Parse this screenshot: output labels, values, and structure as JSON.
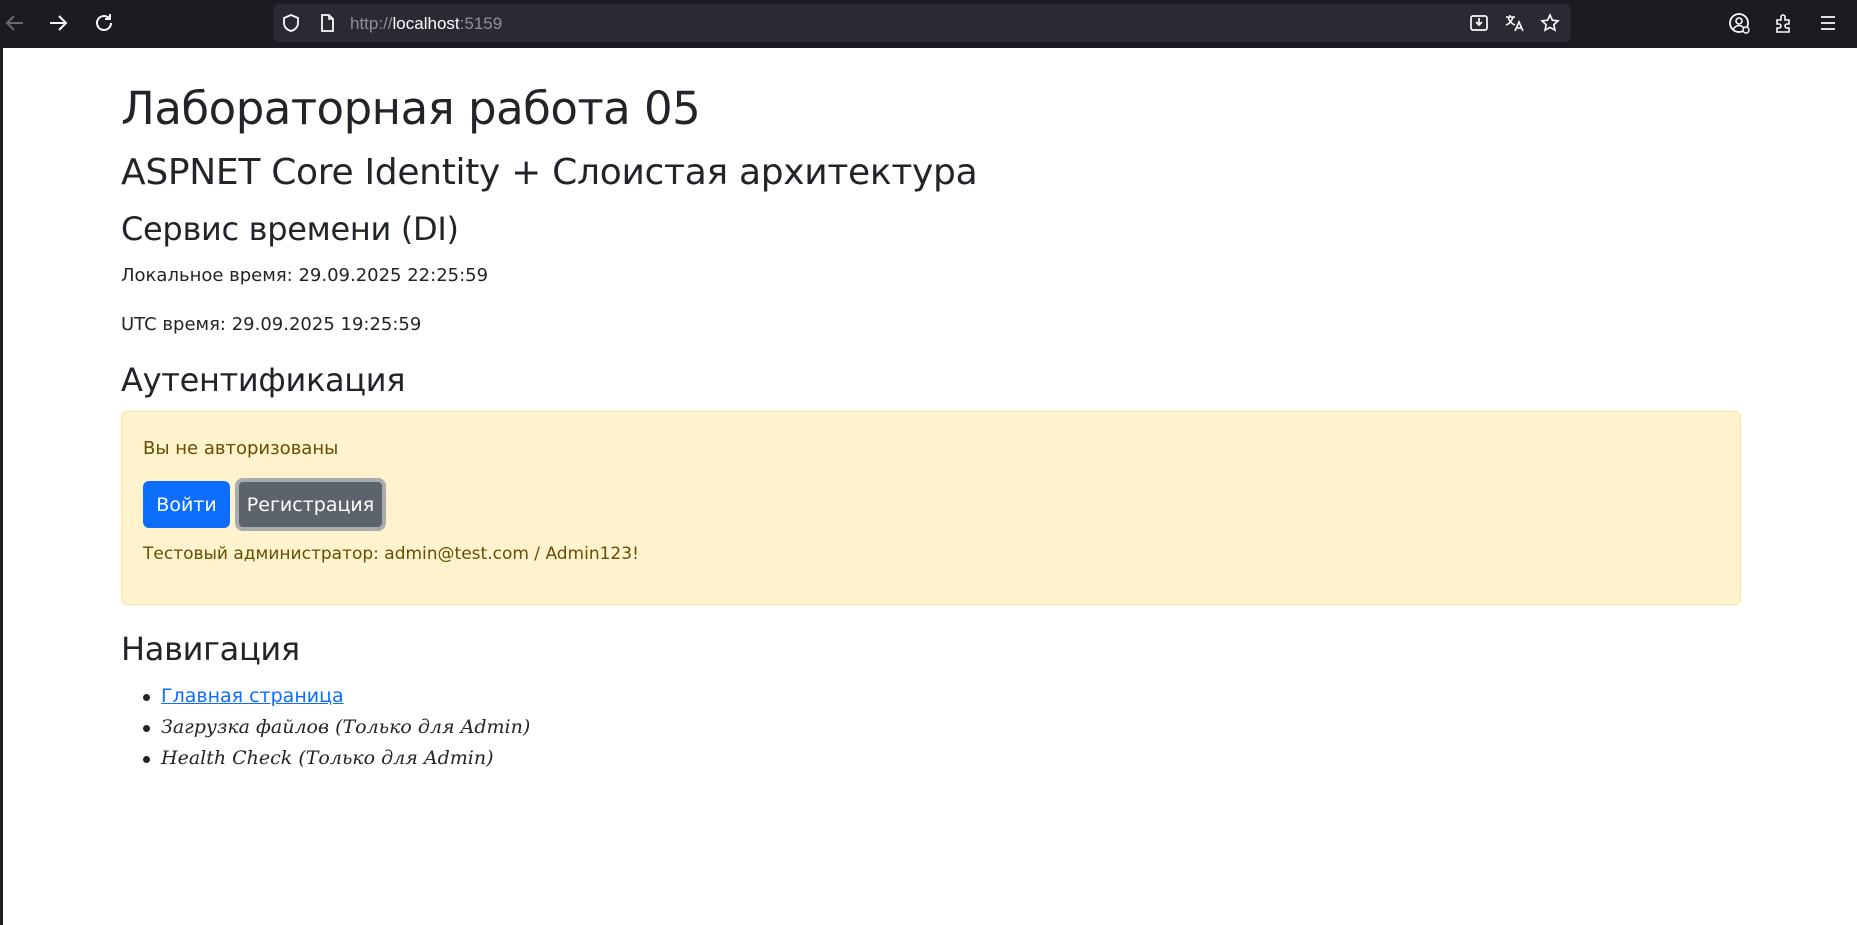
{
  "browser": {
    "url_scheme": "http://",
    "url_host": "localhost",
    "url_port": ":5159",
    "icons": [
      "back-arrow-icon",
      "forward-arrow-icon",
      "reload-icon",
      "shield-icon",
      "page-icon",
      "download-icon",
      "translate-icon",
      "star-icon",
      "account-icon",
      "extensions-icon",
      "menu-icon"
    ]
  },
  "page": {
    "title": "Лабораторная работа 05",
    "subtitle": "ASPNET Core Identity + Слоистая архитектура",
    "time_heading": "Сервис времени (DI)",
    "local_time": "Локальное время: 29.09.2025 22:25:59",
    "utc_time": "UTC время: 29.09.2025 19:25:59",
    "auth_heading": "Аутентификация",
    "auth": {
      "message": "Вы не авторизованы",
      "login_label": "Войти",
      "register_label": "Регистрация",
      "note": "Тестовый администратор: admin@test.com / Admin123!"
    },
    "nav_heading": "Навигация",
    "nav_items": [
      {
        "label": "Главная страница",
        "type": "link"
      },
      {
        "label": "Загрузка файлов (Только для Admin)",
        "type": "text"
      },
      {
        "label": "Health Check (Только для Admin)",
        "type": "text"
      }
    ]
  },
  "colors": {
    "toolbar": "#1c1b22",
    "urlbar": "#2b2a33",
    "primary": "#0d6efd",
    "secondary": "#5c636a",
    "alert_bg": "#fff3cd",
    "alert_text": "#664d03"
  }
}
